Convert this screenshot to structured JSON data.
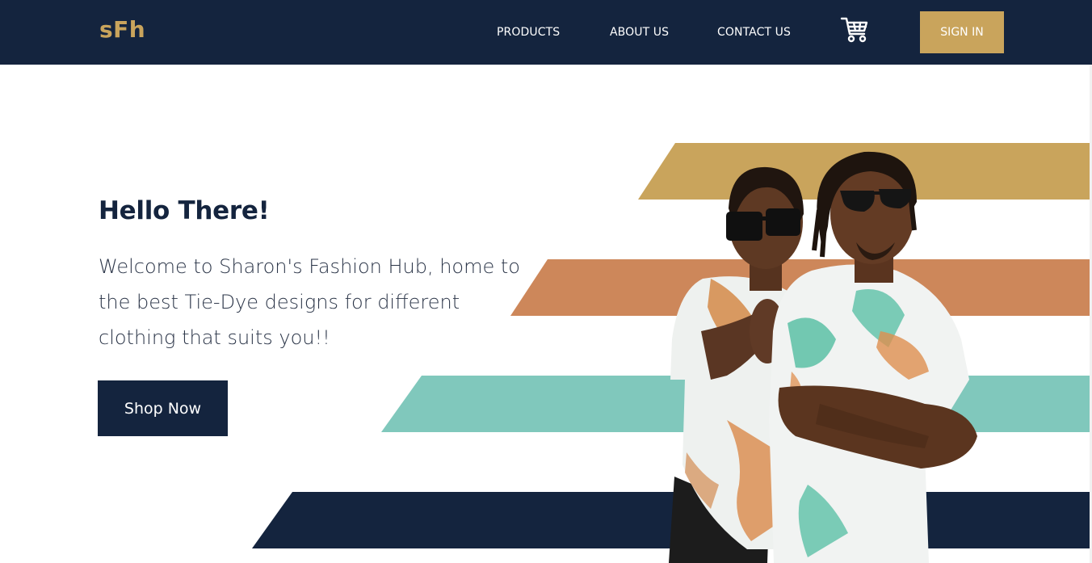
{
  "nav": {
    "logo": "sFh",
    "links": [
      "PRODUCTS",
      "ABOUT US",
      "CONTACT US"
    ],
    "cart_icon": "shopping-cart-icon",
    "signin_label": "SIGN IN"
  },
  "hero": {
    "title": "Hello There!",
    "text_lines": [
      "Welcome to Sharon's Fashion Hub, home to",
      "the best Tie-Dye designs for different",
      "clothing that suits you!!"
    ],
    "cta_label": "Shop Now"
  },
  "colors": {
    "navy": "#14243e",
    "gold": "#c9a45c",
    "orange": "#cd875a",
    "teal": "#80c8bc"
  }
}
